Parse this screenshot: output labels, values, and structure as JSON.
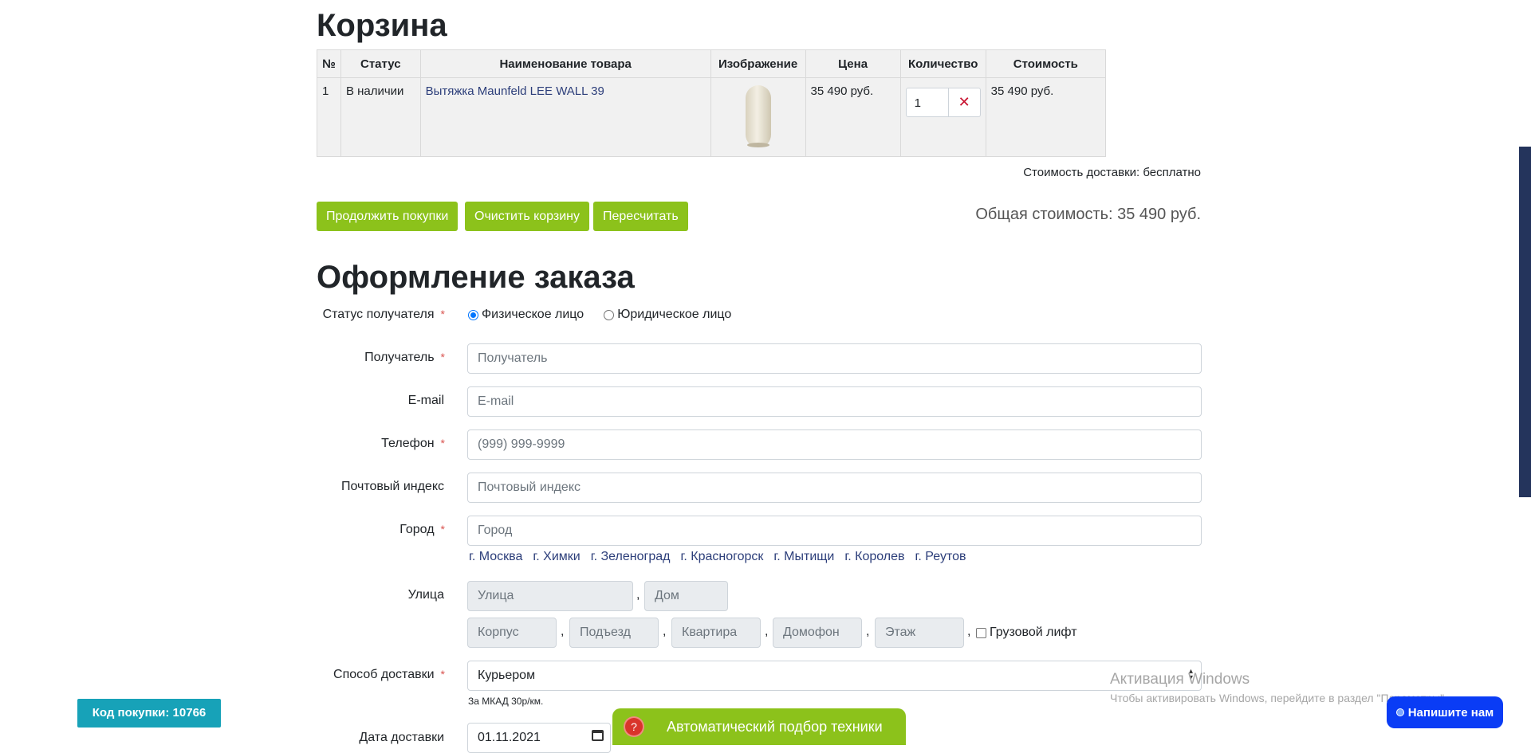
{
  "cart": {
    "title": "Корзина",
    "columns": [
      "№",
      "Статус",
      "Наименование товара",
      "Изображение",
      "Цена",
      "Количество",
      "Стоимость"
    ],
    "items": [
      {
        "num": "1",
        "status": "В наличии",
        "name": "Вытяжка Maunfeld LEE WALL 39",
        "price": "35 490 руб.",
        "qty": "1",
        "total": "35 490 руб."
      }
    ],
    "delivery_cost": "Стоимость доставки: бесплатно",
    "buttons": {
      "continue": "Продолжить покупки",
      "clear": "Очистить корзину",
      "recalc": "Пересчитать"
    },
    "total": "Общая стоимость: 35 490 руб."
  },
  "checkout": {
    "title": "Оформление заказа",
    "recipient_status_label": "Статус получателя",
    "status_options": [
      "Физическое лицо",
      "Юридическое лицо"
    ],
    "recipient": {
      "label": "Получатель",
      "placeholder": "Получатель"
    },
    "email": {
      "label": "E-mail",
      "placeholder": "E-mail"
    },
    "phone": {
      "label": "Телефон",
      "placeholder": "(999) 999-9999"
    },
    "postcode": {
      "label": "Почтовый индекс",
      "placeholder": "Почтовый индекс"
    },
    "city": {
      "label": "Город",
      "placeholder": "Город"
    },
    "cities": [
      "г. Москва",
      "г. Химки",
      "г. Зеленоград",
      "г. Красногорск",
      "г. Мытищи",
      "г. Королев",
      "г. Реутов"
    ],
    "street": {
      "label": "Улица",
      "street_placeholder": "Улица",
      "house_placeholder": "Дом",
      "building_placeholder": "Корпус",
      "entrance_placeholder": "Подъезд",
      "apartment_placeholder": "Квартира",
      "intercom_placeholder": "Домофон",
      "floor_placeholder": "Этаж",
      "cargo_lift": "Грузовой лифт"
    },
    "delivery_method": {
      "label": "Способ доставки",
      "value": "Курьером",
      "hint": "За МКАД 30р/км."
    },
    "delivery_date": {
      "label": "Дата доставки",
      "value": "01.11.2021"
    }
  },
  "widgets": {
    "purchase_code": "Код покупки: 10766",
    "auto_pick": "Автоматический подбор техники",
    "chat": "Напишите нам"
  },
  "watermark": {
    "title": "Активация Windows",
    "subtitle": "Чтобы активировать Windows, перейдите в раздел \"Параметры\"."
  }
}
